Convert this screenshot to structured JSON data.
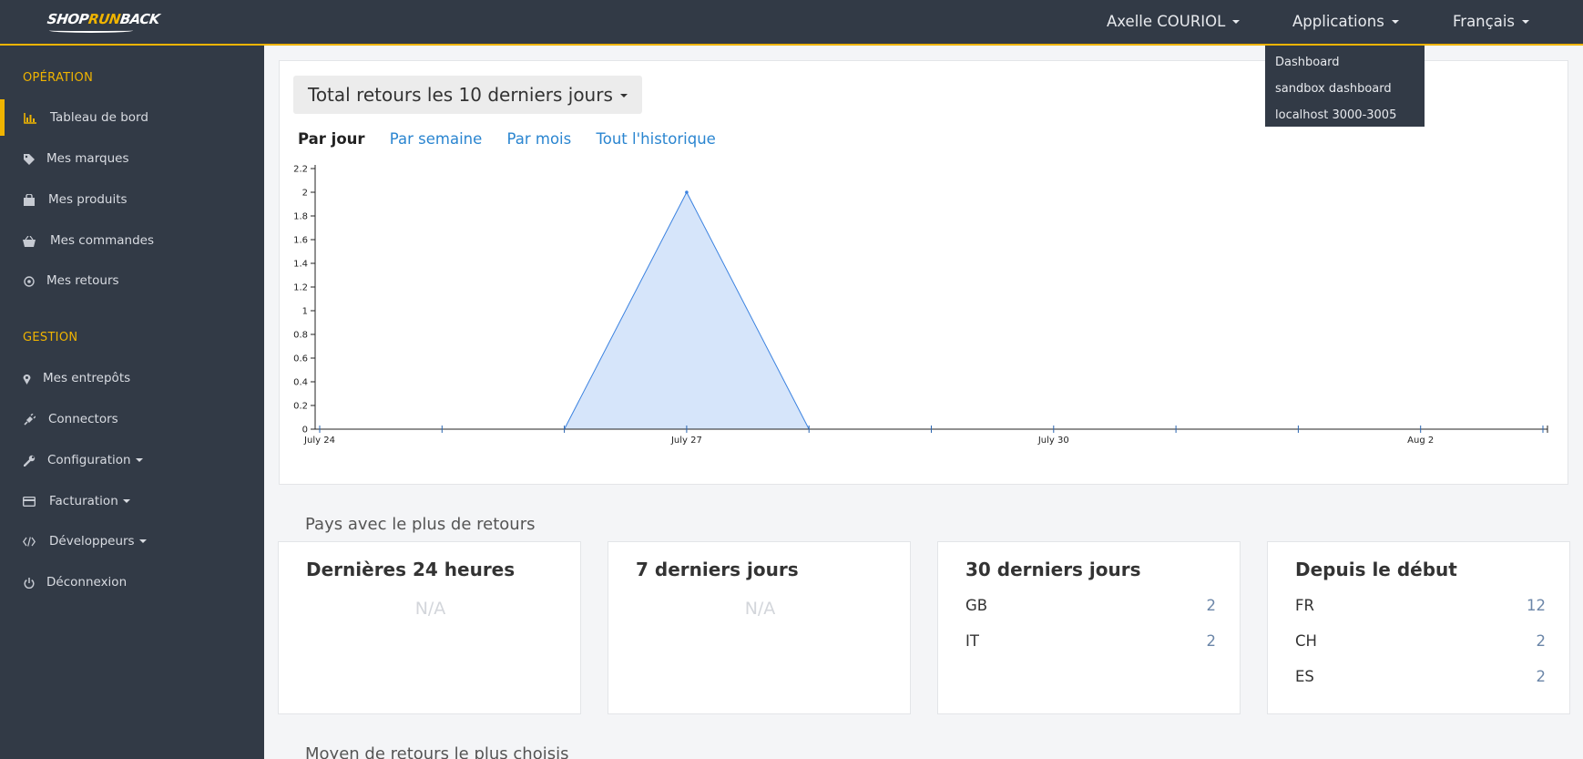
{
  "topbar": {
    "logo_text_a": "SHOP",
    "logo_text_b": "RUN",
    "logo_text_c": "BACK",
    "user_label": "Axelle COURIOL",
    "applications_label": "Applications",
    "language_label": "Français"
  },
  "applications_menu": {
    "items": [
      "Dashboard",
      "sandbox dashboard",
      "localhost 3000-3005"
    ]
  },
  "sidebar": {
    "section_operation": "OPÉRATION",
    "section_gestion": "GESTION",
    "items": [
      {
        "label": "Tableau de bord",
        "icon": "bar-chart-icon"
      },
      {
        "label": "Mes marques",
        "icon": "tag-icon"
      },
      {
        "label": "Mes produits",
        "icon": "shopping-bag-icon"
      },
      {
        "label": "Mes commandes",
        "icon": "basket-icon"
      },
      {
        "label": "Mes retours",
        "icon": "return-circle-icon"
      },
      {
        "label": "Mes entrepôts",
        "icon": "map-marker-icon"
      },
      {
        "label": "Connectors",
        "icon": "plug-icon"
      },
      {
        "label": "Configuration",
        "icon": "wrench-icon"
      },
      {
        "label": "Facturation",
        "icon": "credit-card-icon"
      },
      {
        "label": "Développeurs",
        "icon": "code-icon"
      },
      {
        "label": "Déconnexion",
        "icon": "power-icon"
      }
    ]
  },
  "chart_section": {
    "title_button": "Total retours les 10 derniers jours",
    "tabs": [
      "Par jour",
      "Par semaine",
      "Par mois",
      "Tout l'historique"
    ],
    "active_tab": "Par jour"
  },
  "chart_data": {
    "type": "area",
    "x": [
      "July 24",
      "July 25",
      "July 26",
      "July 27",
      "July 28",
      "July 29",
      "July 30",
      "July 31",
      "Aug 1",
      "Aug 2",
      "Aug 3"
    ],
    "values": [
      0,
      0,
      0,
      2,
      0,
      0,
      0,
      0,
      0,
      0,
      0
    ],
    "x_tick_labels": [
      "July 24",
      "July 27",
      "July 30",
      "Aug 2"
    ],
    "y_ticks": [
      "0",
      "0.2",
      "0.4",
      "0.6",
      "0.8",
      "1",
      "1.2",
      "1.4",
      "1.6",
      "1.8",
      "2",
      "2.2"
    ],
    "ylim": [
      0,
      2.2
    ],
    "title": "",
    "xlabel": "",
    "ylabel": "",
    "grid": false,
    "color": "#3b82e0",
    "fill": "#d6e5fa"
  },
  "countries": {
    "heading": "Pays avec le plus de retours",
    "cards": [
      {
        "title": "Dernières 24 heures",
        "empty": "N/A",
        "rows": []
      },
      {
        "title": "7 derniers jours",
        "empty": "N/A",
        "rows": []
      },
      {
        "title": "30 derniers jours",
        "rows": [
          {
            "country": "GB",
            "value": "2"
          },
          {
            "country": "IT",
            "value": "2"
          }
        ]
      },
      {
        "title": "Depuis le début",
        "rows": [
          {
            "country": "FR",
            "value": "12"
          },
          {
            "country": "CH",
            "value": "2"
          },
          {
            "country": "ES",
            "value": "2"
          }
        ]
      }
    ]
  },
  "bottom_heading": "Moyen de retours le plus choisis"
}
